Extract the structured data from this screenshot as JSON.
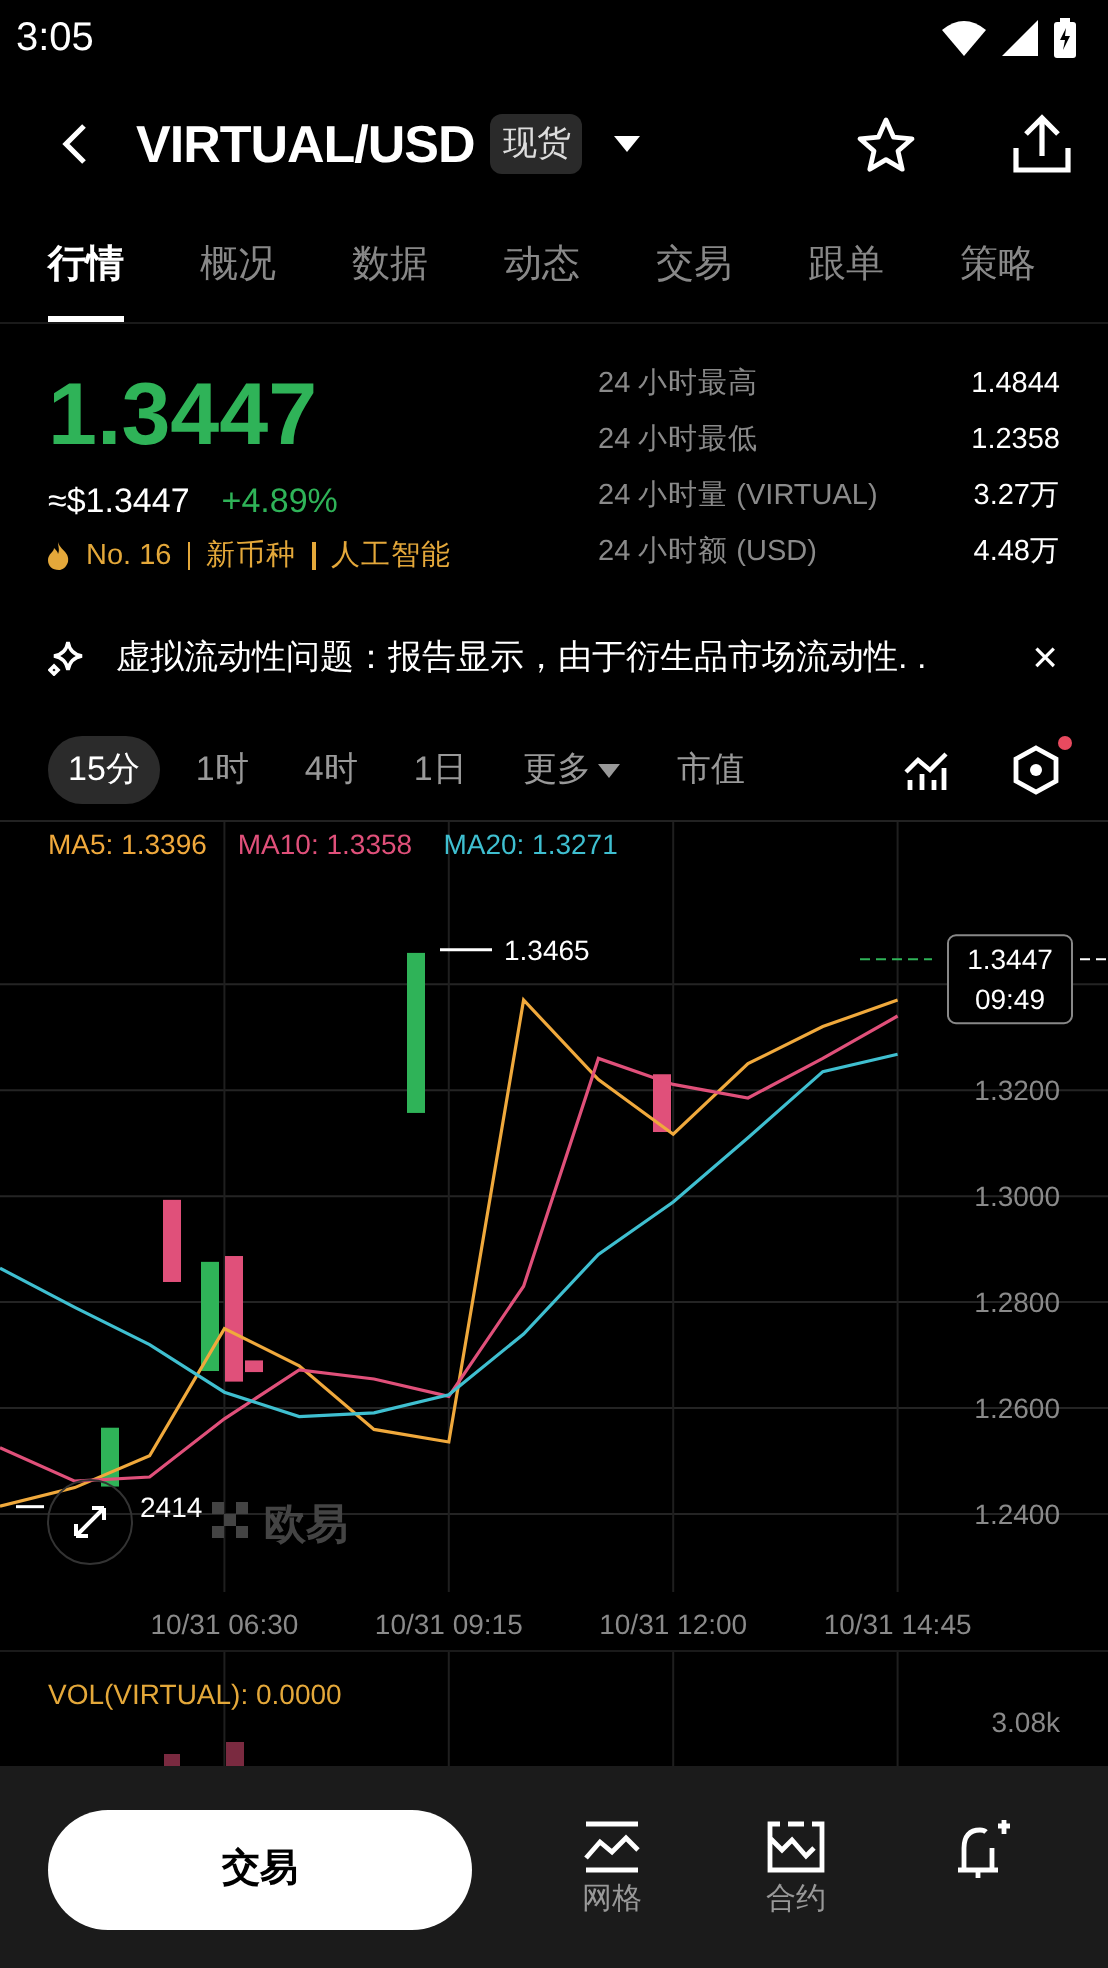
{
  "status_bar": {
    "time": "3:05"
  },
  "header": {
    "pair": "VIRTUAL/USD",
    "market_badge": "现货"
  },
  "tabs": [
    {
      "label": "行情",
      "selected": true
    },
    {
      "label": "概况",
      "selected": false
    },
    {
      "label": "数据",
      "selected": false
    },
    {
      "label": "动态",
      "selected": false
    },
    {
      "label": "交易",
      "selected": false
    },
    {
      "label": "跟单",
      "selected": false
    },
    {
      "label": "策略",
      "selected": false
    }
  ],
  "ticker": {
    "price": "1.3447",
    "approx_price": "≈$1.3447",
    "change": "+4.89%",
    "tags": [
      "No. 16",
      "新币种",
      "人工智能"
    ],
    "stats": [
      {
        "label": "24 小时最高",
        "value": "1.4844"
      },
      {
        "label": "24 小时最低",
        "value": "1.2358"
      },
      {
        "label": "24 小时量 (VIRTUAL)",
        "value": "3.27万"
      },
      {
        "label": "24 小时额 (USD)",
        "value": "4.48万"
      }
    ]
  },
  "news": {
    "text": "虚拟流动性问题：报告显示，由于衍生品市场流动性. .",
    "close": "×"
  },
  "intervals": [
    {
      "label": "15分",
      "kind": "interval",
      "selected": true
    },
    {
      "label": "1时",
      "kind": "interval",
      "selected": false
    },
    {
      "label": "4时",
      "kind": "interval",
      "selected": false
    },
    {
      "label": "1日",
      "kind": "interval",
      "selected": false
    },
    {
      "label": "更多",
      "kind": "dropdown",
      "selected": false
    },
    {
      "label": "市值",
      "kind": "interval",
      "selected": false
    }
  ],
  "chart": {
    "legend": [
      {
        "reading": ": 1.3396"
      },
      {
        "reading": ": 1.3358"
      },
      {
        "reading": ": 1.3271"
      }
    ],
    "high_label": "1.3465",
    "low_label": "2414",
    "price_tag": {
      "price": "1.3447",
      "time": "09:49"
    },
    "watermark": "欧易",
    "chart_data": {
      "type": "line",
      "grid": true,
      "categories": [
        null,
        null,
        null,
        "10/31 06:30",
        null,
        null,
        "10/31 09:15",
        null,
        null,
        "10/31 12:00",
        null,
        null,
        "10/31 14:45"
      ],
      "ylim": [
        1.2253,
        1.3706
      ],
      "yticks": [
        {
          "value": 1.24,
          "label": "1.2400"
        },
        {
          "value": 1.26,
          "label": "1.2600"
        },
        {
          "value": 1.28,
          "label": "1.2800"
        },
        {
          "value": 1.3,
          "label": "1.3000"
        },
        {
          "value": 1.32,
          "label": "1.3200"
        }
      ],
      "series": [
        {
          "name": "MA5",
          "color": "#f0a93c",
          "values": [
            1.2415,
            1.245,
            1.251,
            1.275,
            1.268,
            1.256,
            1.2536,
            1.337,
            1.322,
            1.3117,
            1.325,
            1.332,
            1.337
          ]
        },
        {
          "name": "MA10",
          "color": "#e0507a",
          "values": [
            1.2525,
            1.2462,
            1.247,
            1.258,
            1.2672,
            1.2655,
            1.2622,
            1.283,
            1.326,
            1.3211,
            1.3185,
            1.326,
            1.334
          ]
        },
        {
          "name": "MA20",
          "color": "#3fbfd0",
          "values": [
            1.2864,
            1.279,
            1.272,
            1.263,
            1.2584,
            1.2591,
            1.2625,
            1.274,
            1.289,
            1.2989,
            1.311,
            1.3235,
            1.3268
          ]
        }
      ]
    }
  },
  "volume": {
    "label": "VOL(VIRTUAL): 0.0000",
    "axis_label": "3.08k"
  },
  "bottom_bar": {
    "trade_button": "交易",
    "actions": [
      {
        "kind": "grid",
        "label": "网格"
      },
      {
        "kind": "contract",
        "label": "合约"
      },
      {
        "kind": "alert"
      }
    ]
  }
}
